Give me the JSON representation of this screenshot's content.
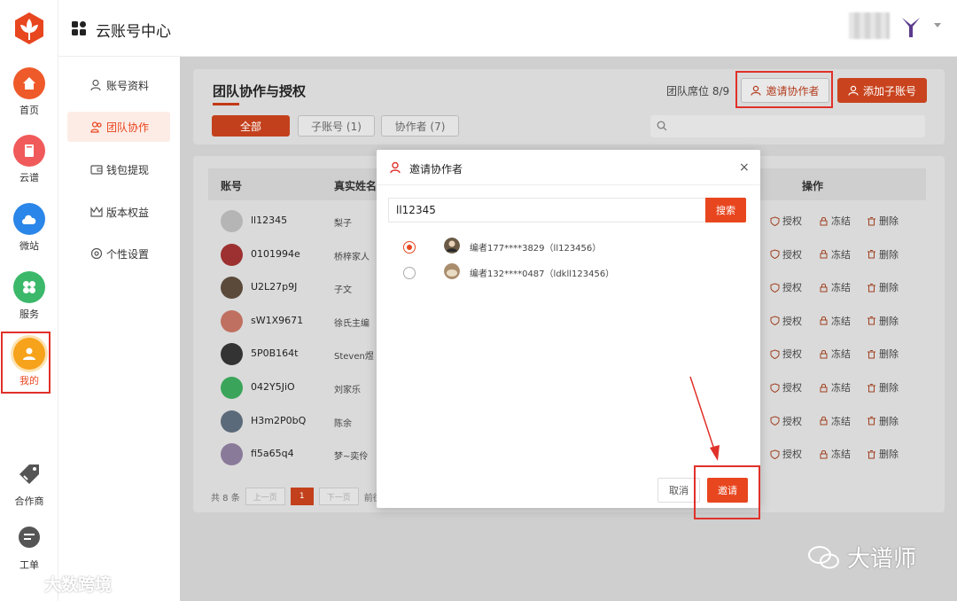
{
  "header": {
    "title": "云账号中心"
  },
  "rail": {
    "items": [
      {
        "label": "首页",
        "icon": "home-icon"
      },
      {
        "label": "云谱",
        "icon": "book-icon"
      },
      {
        "label": "微站",
        "icon": "cloud-icon"
      },
      {
        "label": "服务",
        "icon": "clover-icon"
      },
      {
        "label": "我的",
        "icon": "user-icon",
        "active": true
      },
      {
        "label": "合作商",
        "icon": "tag-icon"
      },
      {
        "label": "工单",
        "icon": "chat-icon"
      }
    ]
  },
  "subnav": {
    "items": [
      {
        "label": "账号资料"
      },
      {
        "label": "团队协作",
        "active": true
      },
      {
        "label": "钱包提现"
      },
      {
        "label": "版本权益"
      },
      {
        "label": "个性设置"
      }
    ]
  },
  "main": {
    "title": "团队协作与授权",
    "seat": "团队席位 8/9",
    "invite_label": "邀请协作者",
    "add_label": "添加子账号",
    "tabs": [
      "全部",
      "子账号 (1)",
      "协作者 (7)"
    ]
  },
  "table": {
    "columns": [
      "账号",
      "真实姓名",
      "操作"
    ],
    "rows": [
      {
        "account": "ll12345",
        "name": "梨子"
      },
      {
        "account": "0101994e",
        "name": "桥梓家人"
      },
      {
        "account": "U2L27p9J",
        "name": "子文"
      },
      {
        "account": "sW1X9671",
        "name": "徐氏主编"
      },
      {
        "account": "5P0B164t",
        "name": "Steven煜"
      },
      {
        "account": "042Y5JiO",
        "name": "刘家乐"
      },
      {
        "account": "H3m2P0bQ",
        "name": "陈余"
      },
      {
        "account": "fi5a65q4",
        "name": "梦~奕伶"
      }
    ],
    "actions": {
      "auth": "授权",
      "freeze": "冻结",
      "delete": "删除"
    },
    "pager": {
      "total": "共 8 条",
      "prev": "上一页",
      "page": "1",
      "next": "下一页",
      "goto": "前往"
    }
  },
  "modal": {
    "title": "邀请协作者",
    "close": "×",
    "input_value": "ll12345",
    "search_label": "搜索",
    "results": [
      {
        "text": "编者177****3829（ll123456）",
        "selected": true
      },
      {
        "text": "编者132****0487（ldkll123456）",
        "selected": false
      }
    ],
    "cancel_label": "取消",
    "ok_label": "邀请"
  },
  "watermarks": {
    "right": "大谱师",
    "left": "大数跨境"
  },
  "colors": {
    "accent": "#e8461f",
    "highlight": "#e0312a"
  }
}
